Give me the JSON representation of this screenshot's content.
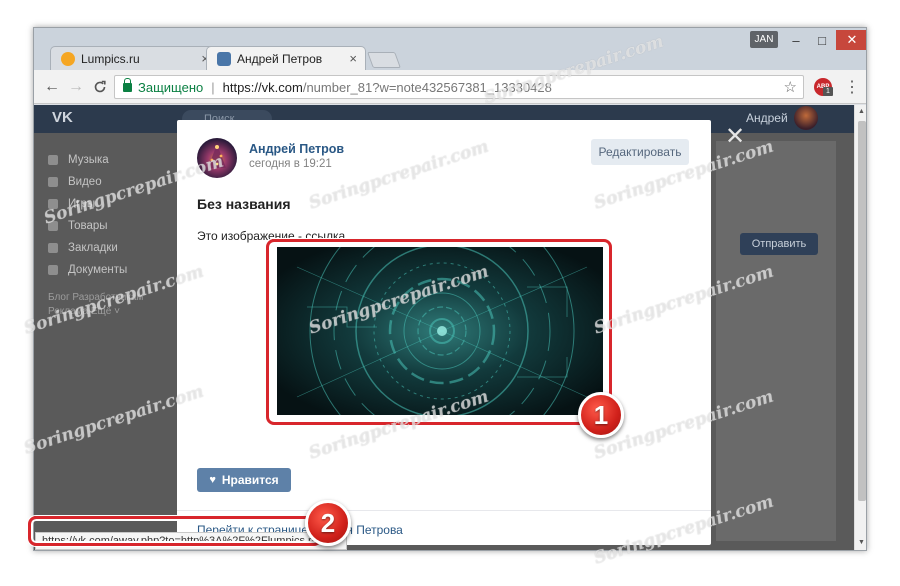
{
  "browser": {
    "tabs": [
      {
        "label": "Lumpics.ru",
        "favicon_color": "#f5a623"
      },
      {
        "label": "Андрей Петров",
        "favicon_color": "#4a76a8"
      }
    ],
    "tab_close_glyph": "×",
    "profile_badge": "JAN",
    "window_controls": {
      "minimize": "–",
      "maximize": "□",
      "close": "✕"
    },
    "nav": {
      "back": "←",
      "forward": "→",
      "reload": "C"
    },
    "address": {
      "secure_label": "Защищено",
      "separator": "|",
      "host": "https://vk.com",
      "path": "/number_81?w=note432567381_13330428"
    },
    "bookmark_glyph": "☆",
    "extension": {
      "label": "ABP",
      "badge": "1"
    },
    "menu_glyph": "⋮"
  },
  "vk": {
    "logo": "VK",
    "search_placeholder": "Поиск",
    "user_name": "Андрей",
    "menu": [
      {
        "label": "Музыка"
      },
      {
        "label": "Видео"
      },
      {
        "label": "Игры"
      },
      {
        "label": "Товары"
      },
      {
        "label": "Закладки"
      },
      {
        "label": "Документы"
      }
    ],
    "menu_footer_1": "Блог  Разработчикам",
    "menu_footer_2": "Реклама  Ещё ˅",
    "send_label": "Отправить"
  },
  "modal": {
    "close_glyph": "✕",
    "author_name": "Андрей Петров",
    "timestamp": "сегодня в 19:21",
    "edit_label": "Редактировать",
    "title": "Без названия",
    "body_text": "Это изображение - ссылка",
    "like_label": "Нравится",
    "like_glyph": "♥",
    "footer_link": "Перейти к странице Андрея Петрова"
  },
  "status_url": "https://vk.com/away.php?to=http%3A%2F%2Flumpics.ru%2F",
  "annotations": [
    {
      "number": "1"
    },
    {
      "number": "2"
    }
  ],
  "watermark": "Soringpcrepair.com",
  "colors": {
    "highlight_red": "#d8262c",
    "vk_link_blue": "#2a5885",
    "like_button": "#5e81a8"
  }
}
